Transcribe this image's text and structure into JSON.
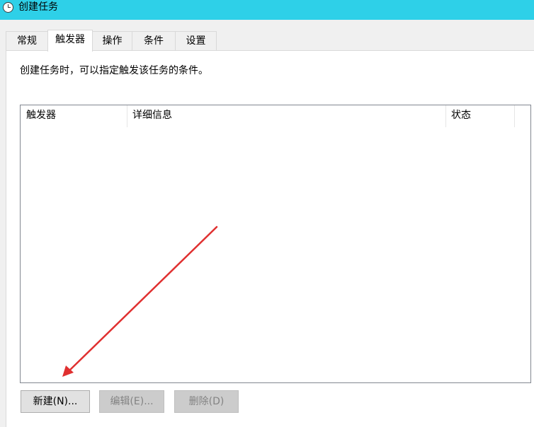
{
  "window": {
    "title": "创建任务"
  },
  "tabs": [
    {
      "label": "常规",
      "active": false
    },
    {
      "label": "触发器",
      "active": true
    },
    {
      "label": "操作",
      "active": false
    },
    {
      "label": "条件",
      "active": false
    },
    {
      "label": "设置",
      "active": false
    }
  ],
  "panel": {
    "description": "创建任务时，可以指定触发该任务的条件。"
  },
  "trigger_list": {
    "columns": [
      "触发器",
      "详细信息",
      "状态"
    ],
    "rows": []
  },
  "buttons": {
    "new_label": "新建(N)...",
    "edit_label": "编辑(E)...",
    "delete_label": "删除(D)"
  },
  "colors": {
    "titlebar": "#2ed0e8",
    "arrow": "#e03030"
  },
  "icons": {
    "title_icon": "clock-icon"
  }
}
